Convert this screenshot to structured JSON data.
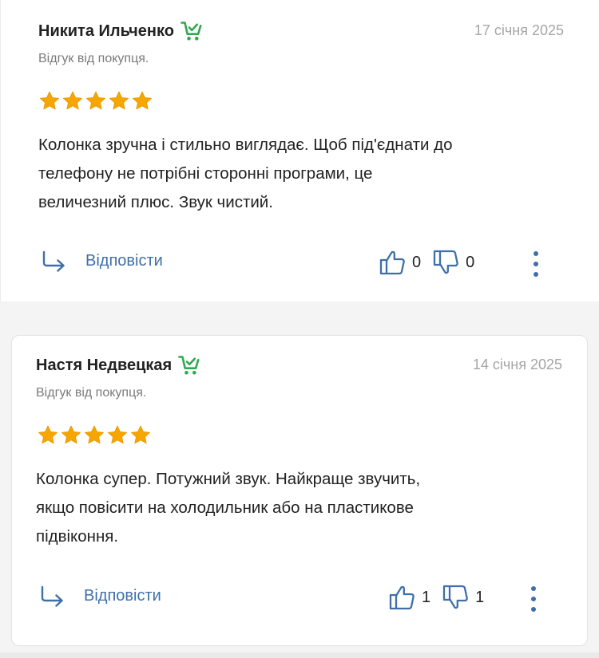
{
  "colors": {
    "accent": "#3f6fa9",
    "star": "#f7a600",
    "seller_badge": "#2fa84f",
    "date": "#a6a6a6"
  },
  "reviews": [
    {
      "author": "Никита Ильченко",
      "badge_icon": "cart-check-icon",
      "date": "17 січня 2025",
      "subtitle": "Відгук від покупця.",
      "rating": 5,
      "text_lines": [
        "Колонка зручна і стильно виглядає. Щоб під'єднати до",
        "телефону не потрібні сторонні програми, це",
        "величезний плюс. Звук чистий."
      ],
      "reply_label": "Відповісти",
      "likes": "0",
      "dislikes": "0"
    },
    {
      "author": "Настя Недвецкая",
      "badge_icon": "cart-check-icon",
      "date": "14 січня 2025",
      "subtitle": "Відгук від покупця.",
      "rating": 5,
      "text_lines": [
        "Колонка супер. Потужний звук. Найкраще звучить,",
        "якщо повісити на холодильник або на пластикове",
        "підвіконня."
      ],
      "reply_label": "Відповісти",
      "likes": "1",
      "dislikes": "1"
    }
  ]
}
